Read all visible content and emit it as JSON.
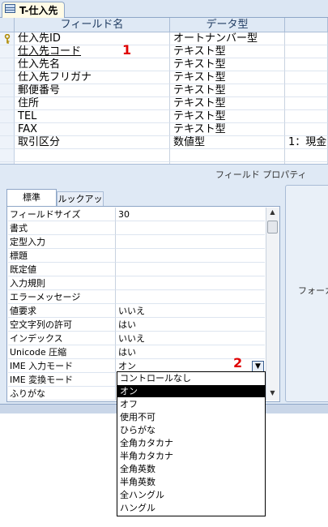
{
  "tab": {
    "label": "T-仕入先"
  },
  "grid": {
    "columns": [
      "フィールド名",
      "データ型"
    ],
    "rows": [
      {
        "field": "仕入先ID",
        "type": "オートナンバー型",
        "desc": ""
      },
      {
        "field": "仕入先コード",
        "type": "テキスト型",
        "desc": ""
      },
      {
        "field": "仕入先名",
        "type": "テキスト型",
        "desc": ""
      },
      {
        "field": "仕入先フリガナ",
        "type": "テキスト型",
        "desc": ""
      },
      {
        "field": "郵便番号",
        "type": "テキスト型",
        "desc": ""
      },
      {
        "field": "住所",
        "type": "テキスト型",
        "desc": ""
      },
      {
        "field": "TEL",
        "type": "テキスト型",
        "desc": ""
      },
      {
        "field": "FAX",
        "type": "テキスト型",
        "desc": ""
      },
      {
        "field": "取引区分",
        "type": "数値型",
        "desc": "1：現金"
      }
    ]
  },
  "properties": {
    "title": "フィールド プロパティ",
    "tabs": [
      "標準",
      "ルックアップ"
    ],
    "rows": [
      {
        "label": "フィールドサイズ",
        "value": "30"
      },
      {
        "label": "書式",
        "value": ""
      },
      {
        "label": "定型入力",
        "value": ""
      },
      {
        "label": "標題",
        "value": ""
      },
      {
        "label": "既定値",
        "value": ""
      },
      {
        "label": "入力規則",
        "value": ""
      },
      {
        "label": "エラーメッセージ",
        "value": ""
      },
      {
        "label": "値要求",
        "value": "いいえ"
      },
      {
        "label": "空文字列の許可",
        "value": "はい"
      },
      {
        "label": "インデックス",
        "value": "いいえ"
      },
      {
        "label": "Unicode 圧縮",
        "value": "はい"
      },
      {
        "label": "IME 入力モード",
        "value": "オン"
      },
      {
        "label": "IME 変換モード",
        "value": ""
      },
      {
        "label": "ふりがな",
        "value": ""
      }
    ],
    "help_text": "フォーカス"
  },
  "annotations": {
    "one": "1",
    "two": "2"
  },
  "dropdown": {
    "selected": "オン",
    "options": [
      "コントロールなし",
      "オン",
      "オフ",
      "使用不可",
      "ひらがな",
      "全角カタカナ",
      "半角カタカナ",
      "全角英数",
      "半角英数",
      "全ハングル",
      "ハングル"
    ]
  }
}
